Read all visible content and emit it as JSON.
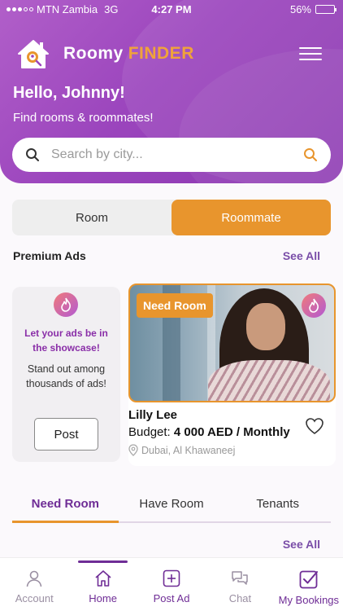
{
  "status_bar": {
    "carrier": "MTN Zambia",
    "network": "3G",
    "time": "4:27 PM",
    "battery": "56%",
    "battery_level": 0.56
  },
  "brand": {
    "name_white": "Roomy",
    "name_orange": "FINDER"
  },
  "greeting": {
    "title": "Hello, Johnny!",
    "subtitle": "Find rooms & roommates!"
  },
  "search": {
    "placeholder": "Search by city..."
  },
  "toggle": {
    "options": [
      "Room",
      "Roommate"
    ],
    "selected": "Roommate"
  },
  "premium": {
    "title": "Premium Ads",
    "see_all": "See All",
    "promo": {
      "headline": "Let your ads be in the showcase!",
      "body": "Stand out among thousands of ads!",
      "button": "Post"
    },
    "ad": {
      "badge": "Need Room",
      "name": "Lilly Lee",
      "budget_label": "Budget:",
      "budget_value": "4 000 AED / Monthly",
      "location": "Dubai, Al Khawaneej"
    }
  },
  "tabs": {
    "items": [
      "Need Room",
      "Have Room",
      "Tenants"
    ],
    "selected": "Need Room",
    "see_all": "See All"
  },
  "bottom_nav": {
    "items": [
      {
        "label": "Account",
        "icon": "user-icon"
      },
      {
        "label": "Home",
        "icon": "home-icon"
      },
      {
        "label": "Post Ad",
        "icon": "plus-square-icon"
      },
      {
        "label": "Chat",
        "icon": "chat-icon"
      },
      {
        "label": "My Bookings",
        "icon": "checkbox-icon"
      }
    ],
    "selected": "Home"
  },
  "colors": {
    "purple": "#9b45bd",
    "orange": "#e8952d",
    "dark_purple": "#6f2d96"
  }
}
